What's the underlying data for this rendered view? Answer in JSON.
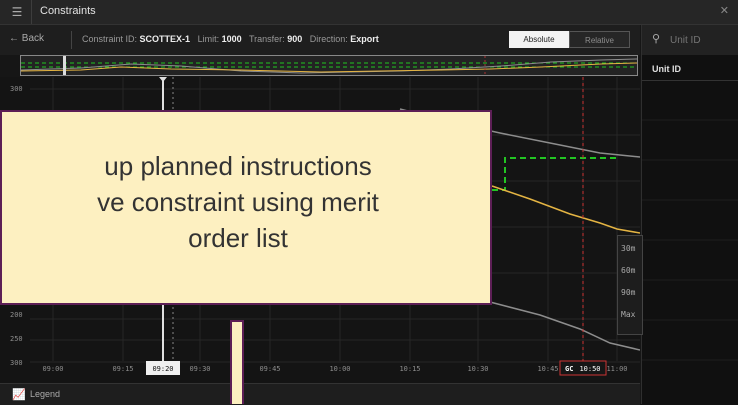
{
  "window": {
    "title": "Constraints",
    "menu_icon": "hamburger-icon",
    "close_icon": "close-icon"
  },
  "toolbar": {
    "back_label": "Back",
    "constraint_label": "Constraint ID:",
    "constraint_value": "SCOTTEX-1",
    "limit_label": "Limit:",
    "limit_value": "1000",
    "transfer_label": "Transfer:",
    "transfer_value": "900",
    "direction_label": "Direction:",
    "direction_value": "Export",
    "mode_absolute": "Absolute",
    "mode_relative": "Relative"
  },
  "side_panel": {
    "search_placeholder": "Unit ID",
    "column_header": "Unit ID"
  },
  "chart_data": {
    "type": "line",
    "y_ticks": [
      "300",
      "200",
      "250",
      "300"
    ],
    "x_ticks": [
      "09:00",
      "09:15",
      "09:20",
      "09:30",
      "09:45",
      "10:00",
      "10:15",
      "10:30",
      "10:45",
      "10:50",
      "11:00"
    ],
    "current_time": "09:20",
    "gate_closure_label": "GC",
    "gate_closure_time": "10:50",
    "horizon_options": [
      "30m",
      "60m",
      "90m",
      "Max"
    ]
  },
  "legend": {
    "label": "Legend"
  },
  "callout": {
    "text": "up planned instructions\nve constraint using merit\norder list"
  },
  "colors": {
    "accent": "#22c522",
    "series_orange": "#e4b443",
    "series_grey": "#8d8d8d",
    "callout_bg": "#fdf0c1",
    "callout_border": "#5d1f56"
  }
}
